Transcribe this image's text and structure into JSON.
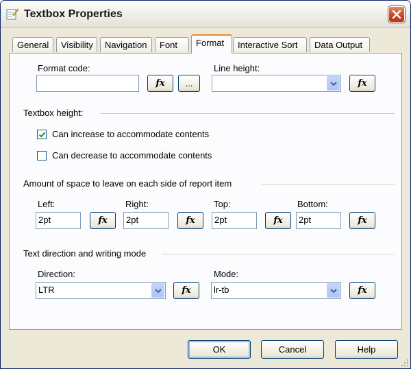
{
  "window": {
    "title": "Textbox Properties"
  },
  "tabs": [
    {
      "label": "General"
    },
    {
      "label": "Visibility"
    },
    {
      "label": "Navigation"
    },
    {
      "label": "Font"
    },
    {
      "label": "Format",
      "active": true
    },
    {
      "label": "Interactive Sort"
    },
    {
      "label": "Data Output"
    }
  ],
  "format": {
    "format_code_label": "Format code:",
    "format_code_value": "",
    "line_height_label": "Line height:",
    "line_height_value": "",
    "fx_label": "fx",
    "ellipsis_label": "..."
  },
  "textbox_height": {
    "heading": "Textbox height:",
    "can_increase": {
      "label": "Can increase to accommodate contents",
      "checked": true
    },
    "can_decrease": {
      "label": "Can decrease to accommodate contents",
      "checked": false
    }
  },
  "spacing": {
    "heading": "Amount of space to leave on each side of report item",
    "left": {
      "label": "Left:",
      "value": "2pt"
    },
    "right": {
      "label": "Right:",
      "value": "2pt"
    },
    "top": {
      "label": "Top:",
      "value": "2pt"
    },
    "bottom": {
      "label": "Bottom:",
      "value": "2pt"
    }
  },
  "text_direction": {
    "heading": "Text direction and writing mode",
    "direction": {
      "label": "Direction:",
      "value": "LTR"
    },
    "mode": {
      "label": "Mode:",
      "value": "lr-tb"
    }
  },
  "footer": {
    "ok": "OK",
    "cancel": "Cancel",
    "help": "Help"
  },
  "colors": {
    "active_tab_accent": "#e68b2c",
    "close_button": "#c64522",
    "check_mark": "#21a121"
  }
}
